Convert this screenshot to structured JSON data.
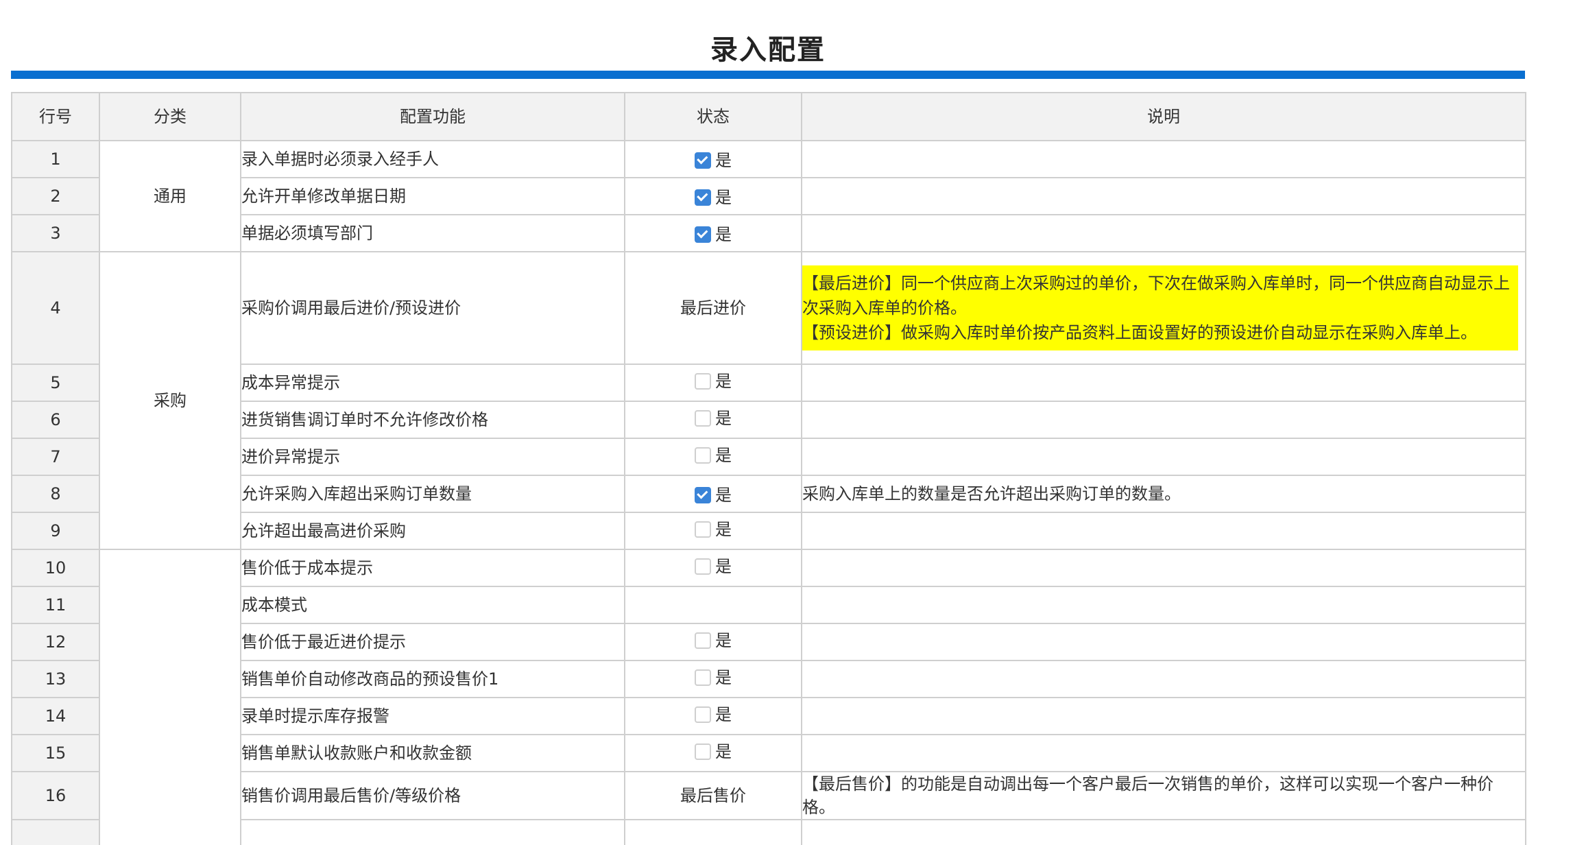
{
  "page": {
    "title": "录入配置"
  },
  "table": {
    "headers": [
      "行号",
      "分类",
      "配置功能",
      "状态",
      "说明"
    ],
    "categories": {
      "general": "通用",
      "purchase": "采购"
    },
    "rows": [
      {
        "num": "1",
        "feature": "录入单据时必须录入经手人",
        "checked": true,
        "label": "是",
        "desc": ""
      },
      {
        "num": "2",
        "feature": "允许开单修改单据日期",
        "checked": true,
        "label": "是",
        "desc": ""
      },
      {
        "num": "3",
        "feature": "单据必须填写部门",
        "checked": true,
        "label": "是",
        "desc": ""
      },
      {
        "num": "4",
        "feature": "采购价调用最后进价/预设进价",
        "status_text": "最后进价",
        "desc_lines": [
          "【最后进价】同一个供应商上次采购过的单价，下次在做采购入库单时，同一个供应商自动显示上次采购入库单的价格。",
          "【预设进价】做采购入库时单价按产品资料上面设置好的预设进价自动显示在采购入库单上。"
        ]
      },
      {
        "num": "5",
        "feature": "成本异常提示",
        "checked": false,
        "label": "是",
        "desc": ""
      },
      {
        "num": "6",
        "feature": "进货销售调订单时不允许修改价格",
        "checked": false,
        "label": "是",
        "desc": ""
      },
      {
        "num": "7",
        "feature": "进价异常提示",
        "checked": false,
        "label": "是",
        "desc": ""
      },
      {
        "num": "8",
        "feature": "允许采购入库超出采购订单数量",
        "checked": true,
        "label": "是",
        "desc": "采购入库单上的数量是否允许超出采购订单的数量。"
      },
      {
        "num": "9",
        "feature": "允许超出最高进价采购",
        "checked": false,
        "label": "是",
        "desc": ""
      },
      {
        "num": "10",
        "feature": "售价低于成本提示",
        "checked": false,
        "label": "是",
        "desc": ""
      },
      {
        "num": "11",
        "feature": "成本模式",
        "desc": ""
      },
      {
        "num": "12",
        "feature": "售价低于最近进价提示",
        "checked": false,
        "label": "是",
        "desc": ""
      },
      {
        "num": "13",
        "feature": "销售单价自动修改商品的预设售价1",
        "checked": false,
        "label": "是",
        "desc": ""
      },
      {
        "num": "14",
        "feature": "录单时提示库存报警",
        "checked": false,
        "label": "是",
        "desc": ""
      },
      {
        "num": "15",
        "feature": "销售单默认收款账户和收款金额",
        "checked": false,
        "label": "是",
        "desc": ""
      },
      {
        "num": "16",
        "feature": "销售价调用最后售价/等级价格",
        "status_text": "最后售价",
        "desc": "【最后售价】的功能是自动调出每一个客户最后一次销售的单价，这样可以实现一个客户一种价格。"
      }
    ]
  },
  "colors": {
    "accent": "#0a6fd0",
    "highlight": "#ffff00",
    "checkbox_on": "#3a84d8"
  },
  "icons": {
    "checkbox_checked": "checkbox-checked-icon",
    "checkbox_unchecked": "checkbox-unchecked-icon"
  }
}
